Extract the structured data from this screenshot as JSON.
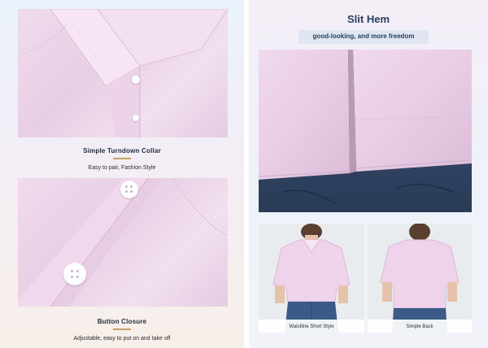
{
  "left": {
    "collar": {
      "title": "Simple Turndown Collar",
      "subtitle": "Easy to pair, Fashion Style"
    },
    "button": {
      "title": "Button Closure",
      "subtitle": "Adjustable, easy to put on and take off"
    }
  },
  "right": {
    "title": "Slit Hem",
    "subtitle": "good-looking, and more freedom",
    "thumbs": [
      {
        "label": "Waistline Short Style"
      },
      {
        "label": "Simple Back"
      }
    ]
  },
  "colors": {
    "fabric_pink": "#efd7ec",
    "denim_navy": "#2f4363",
    "accent_gold": "#c9a062",
    "title_navy": "#27405e"
  }
}
